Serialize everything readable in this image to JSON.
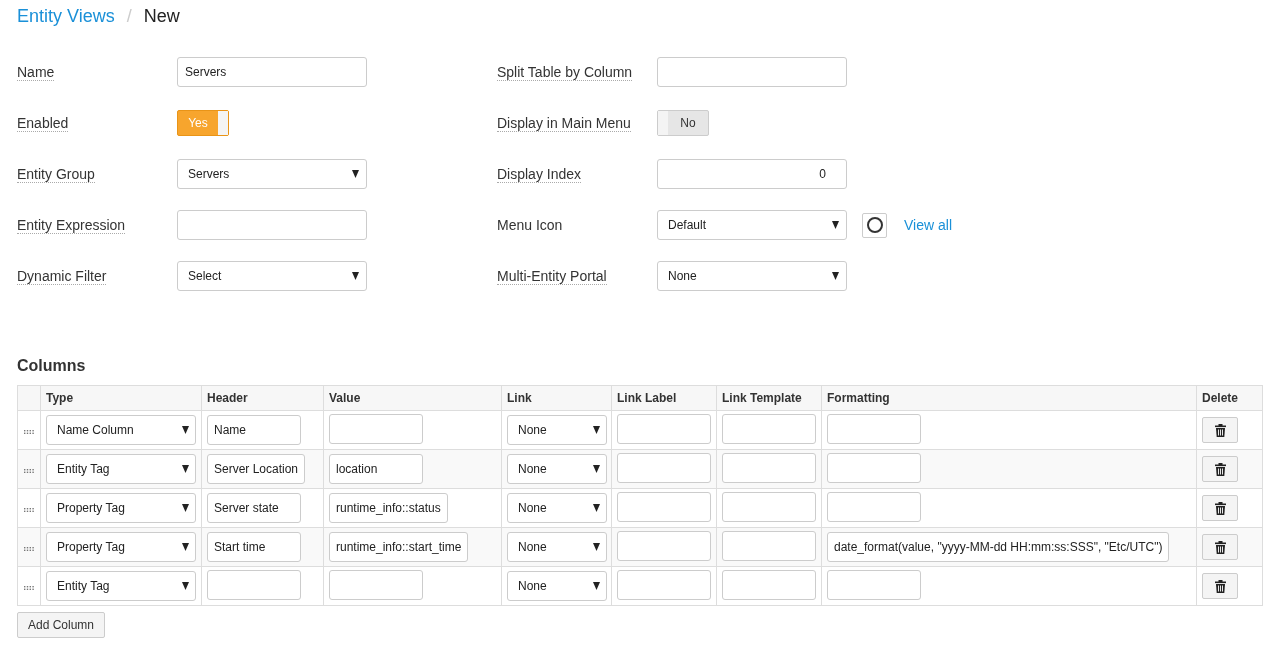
{
  "breadcrumb": {
    "parent": "Entity Views",
    "separator": "/",
    "current": "New"
  },
  "form": {
    "left": [
      {
        "label": "Name",
        "kind": "text",
        "value": "Servers"
      },
      {
        "label": "Enabled",
        "kind": "toggle",
        "on": true,
        "text": "Yes"
      },
      {
        "label": "Entity Group",
        "kind": "select",
        "value": "Servers"
      },
      {
        "label": "Entity Expression",
        "kind": "text"
      },
      {
        "label": "Dynamic Filter",
        "kind": "select",
        "value": "Select"
      }
    ],
    "right": [
      {
        "label": "Split Table by Column",
        "kind": "text"
      },
      {
        "label": "Display in Main Menu",
        "kind": "toggle",
        "on": false,
        "text": "No"
      },
      {
        "label": "Display Index",
        "kind": "number",
        "value": "0"
      },
      {
        "label": "Menu Icon",
        "kind": "icon-select",
        "value": "Default",
        "link": "View all"
      },
      {
        "label": "Multi-Entity Portal",
        "kind": "select",
        "value": "None"
      }
    ]
  },
  "columns": {
    "title": "Columns",
    "headers": [
      "Type",
      "Header",
      "Value",
      "Link",
      "Link Label",
      "Link Template",
      "Formatting",
      "Delete"
    ],
    "rows": [
      {
        "type": "Name Column",
        "header": "Name",
        "link": "None"
      },
      {
        "type": "Entity Tag",
        "header": "Server Location",
        "value": "location",
        "link": "None"
      },
      {
        "type": "Property Tag",
        "header": "Server state",
        "value": "runtime_info::status",
        "link": "None"
      },
      {
        "type": "Property Tag",
        "header": "Start time",
        "value": "runtime_info::start_time",
        "link": "None",
        "formatting": "date_format(value, \"yyyy-MM-dd HH:mm:ss:SSS\", \"Etc/UTC\")"
      },
      {
        "type": "Entity Tag",
        "link": "None"
      }
    ],
    "add_button": "Add Column"
  }
}
